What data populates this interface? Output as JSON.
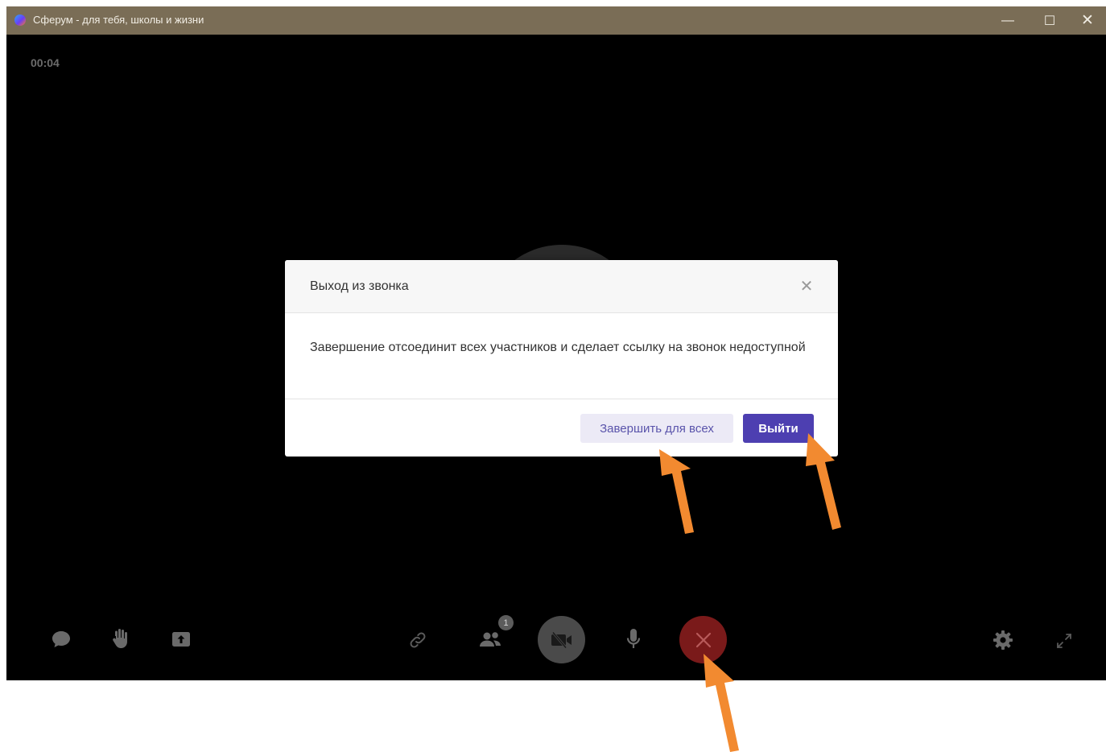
{
  "window": {
    "title": "Сферум - для тебя, школы и жизни",
    "minimize": "—",
    "maximize": "☐",
    "close": "✕"
  },
  "call": {
    "timer": "00:04",
    "participants_count": "1"
  },
  "dialog": {
    "title": "Выход из звонка",
    "close": "✕",
    "message": "Завершение отсоединит всех участников и сделает ссылку на звонок недоступной",
    "end_for_all_label": "Завершить для всех",
    "exit_label": "Выйти"
  },
  "controls": {
    "left": [
      "chat-icon",
      "raise-hand-icon",
      "share-screen-icon"
    ],
    "center": [
      "link-icon",
      "participants-icon",
      "camera-off-icon",
      "microphone-icon",
      "end-call-icon"
    ],
    "right": [
      "settings-icon",
      "fullscreen-icon"
    ]
  },
  "colors": {
    "titlebar": "#7a6d56",
    "call_bg": "#000000",
    "end_call": "#7a1a1a",
    "primary_button": "#4d3fb1",
    "secondary_button": "#eceaf6",
    "annotation_arrow": "#f28a30"
  }
}
